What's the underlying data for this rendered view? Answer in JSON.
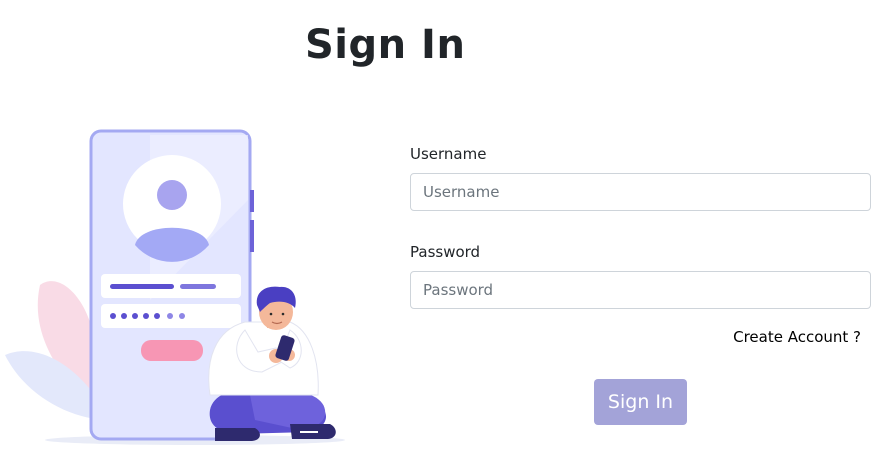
{
  "page": {
    "title": "Sign In"
  },
  "form": {
    "username_label": "Username",
    "username_placeholder": "Username",
    "username_value": "",
    "password_label": "Password",
    "password_placeholder": "Password",
    "password_value": "",
    "create_account_label": "Create Account ?",
    "submit_label": "Sign In"
  },
  "colors": {
    "button_bg": "#a3a3d8",
    "accent_purple": "#6a5acd",
    "phone_body": "#dfe3ff",
    "phone_border": "#9fa6f0",
    "pink": "#f48fb1"
  },
  "illustration": {
    "icon": "person-using-phone-login-illustration"
  }
}
